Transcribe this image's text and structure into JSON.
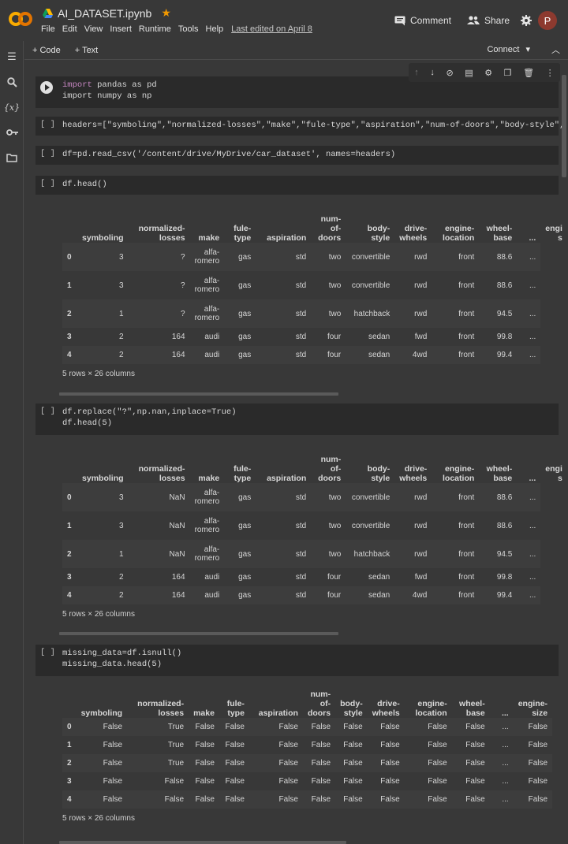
{
  "app": {
    "notebook_title": "AI_DATASET.ipynb",
    "menu": [
      "File",
      "Edit",
      "View",
      "Insert",
      "Runtime",
      "Tools",
      "Help"
    ],
    "last_edited": "Last edited on April 8",
    "comment_label": "Comment",
    "share_label": "Share",
    "avatar_letter": "P",
    "logo_text": "CO"
  },
  "toolbar": {
    "add_code": "+ Code",
    "add_text": "+ Text",
    "connect": "Connect"
  },
  "cells": {
    "c1_line1_kw": "import",
    "c1_line1_rest": " pandas as pd",
    "c1_line2": "import numpy as np",
    "c2": "headers=[\"symboling\",\"normalized-losses\",\"make\",\"fule-type\",\"aspiration\",\"num-of-doors\",\"body-style\",",
    "c3": "df=pd.read_csv('/content/drive/MyDrive/car_dataset', names=headers)",
    "c4": "df.head()",
    "c5_line1": "df.replace(\"?\",np.nan,inplace=True)",
    "c5_line2": "df.head(5)",
    "c6_line1": "missing_data=df.isnull()",
    "c6_line2": "missing_data.head(5)",
    "bracket": "[ ]"
  },
  "tables": {
    "rows_info": "5 rows × 26 columns",
    "headers1": [
      "symboling",
      "normalized-\nlosses",
      "make",
      "fule-\ntype",
      "aspiration",
      "num-\nof-\ndoors",
      "body-\nstyle",
      "drive-\nwheels",
      "engine-\nlocation",
      "wheel-\nbase",
      "...",
      "engi\ns"
    ],
    "df1": [
      [
        "0",
        "3",
        "?",
        "alfa-\nromero",
        "gas",
        "std",
        "two",
        "convertible",
        "rwd",
        "front",
        "88.6",
        "..."
      ],
      [
        "1",
        "3",
        "?",
        "alfa-\nromero",
        "gas",
        "std",
        "two",
        "convertible",
        "rwd",
        "front",
        "88.6",
        "..."
      ],
      [
        "2",
        "1",
        "?",
        "alfa-\nromero",
        "gas",
        "std",
        "two",
        "hatchback",
        "rwd",
        "front",
        "94.5",
        "..."
      ],
      [
        "3",
        "2",
        "164",
        "audi",
        "gas",
        "std",
        "four",
        "sedan",
        "fwd",
        "front",
        "99.8",
        "..."
      ],
      [
        "4",
        "2",
        "164",
        "audi",
        "gas",
        "std",
        "four",
        "sedan",
        "4wd",
        "front",
        "99.4",
        "..."
      ]
    ],
    "df2": [
      [
        "0",
        "3",
        "NaN",
        "alfa-\nromero",
        "gas",
        "std",
        "two",
        "convertible",
        "rwd",
        "front",
        "88.6",
        "..."
      ],
      [
        "1",
        "3",
        "NaN",
        "alfa-\nromero",
        "gas",
        "std",
        "two",
        "convertible",
        "rwd",
        "front",
        "88.6",
        "..."
      ],
      [
        "2",
        "1",
        "NaN",
        "alfa-\nromero",
        "gas",
        "std",
        "two",
        "hatchback",
        "rwd",
        "front",
        "94.5",
        "..."
      ],
      [
        "3",
        "2",
        "164",
        "audi",
        "gas",
        "std",
        "four",
        "sedan",
        "fwd",
        "front",
        "99.8",
        "..."
      ],
      [
        "4",
        "2",
        "164",
        "audi",
        "gas",
        "std",
        "four",
        "sedan",
        "4wd",
        "front",
        "99.4",
        "..."
      ]
    ],
    "headers3": [
      "symboling",
      "normalized-\nlosses",
      "make",
      "fule-\ntype",
      "aspiration",
      "num-\nof-\ndoors",
      "body-\nstyle",
      "drive-\nwheels",
      "engine-\nlocation",
      "wheel-\nbase",
      "...",
      "engine-\nsize"
    ],
    "df3": [
      [
        "0",
        "False",
        "True",
        "False",
        "False",
        "False",
        "False",
        "False",
        "False",
        "False",
        "False",
        "...",
        "False"
      ],
      [
        "1",
        "False",
        "True",
        "False",
        "False",
        "False",
        "False",
        "False",
        "False",
        "False",
        "False",
        "...",
        "False"
      ],
      [
        "2",
        "False",
        "True",
        "False",
        "False",
        "False",
        "False",
        "False",
        "False",
        "False",
        "False",
        "...",
        "False"
      ],
      [
        "3",
        "False",
        "False",
        "False",
        "False",
        "False",
        "False",
        "False",
        "False",
        "False",
        "False",
        "...",
        "False"
      ],
      [
        "4",
        "False",
        "False",
        "False",
        "False",
        "False",
        "False",
        "False",
        "False",
        "False",
        "False",
        "...",
        "False"
      ]
    ]
  },
  "colors": {
    "accent": "#f29900",
    "avatar": "#8d3a2f",
    "background": "#383838",
    "cell_bg": "#2a2a2a"
  }
}
